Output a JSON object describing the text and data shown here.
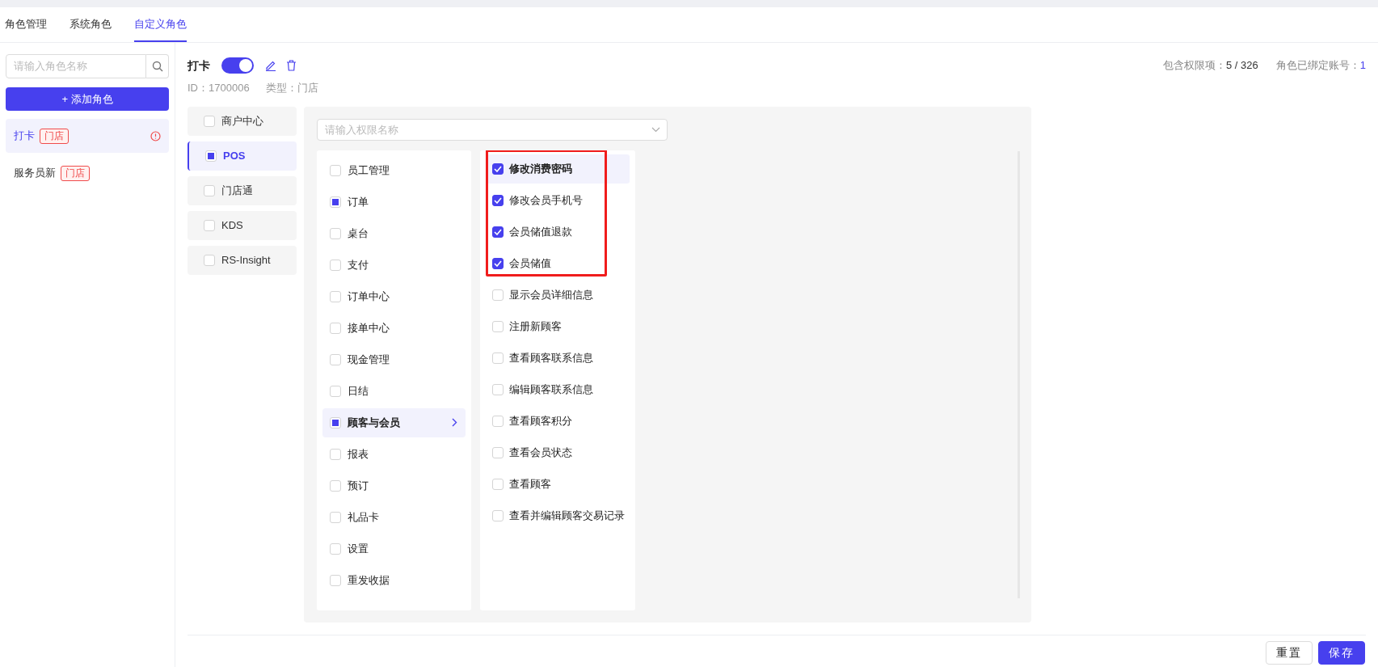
{
  "tabs": [
    {
      "label": "角色管理",
      "selected": false
    },
    {
      "label": "系统角色",
      "selected": false
    },
    {
      "label": "自定义角色",
      "selected": true
    }
  ],
  "sidebar": {
    "search": {
      "placeholder": "请输入角色名称"
    },
    "add_button": "+ 添加角色",
    "roles": [
      {
        "name": "打卡",
        "tag": "门店",
        "selected": true,
        "warning": true
      },
      {
        "name": "服务员新",
        "tag": "门店",
        "selected": false,
        "warning": false
      }
    ]
  },
  "role": {
    "title": "打卡",
    "enabled": true,
    "id_label": "ID：",
    "id": "1700006",
    "type_label": "类型：",
    "type": "门店",
    "permissions_label": "包含权限项：",
    "permissions_count": "5 / 326",
    "accounts_label": "角色已绑定账号：",
    "accounts_count": "1"
  },
  "modules": [
    {
      "label": "商户中心",
      "checked": false,
      "partial": false,
      "selected": false
    },
    {
      "label": "POS",
      "checked": false,
      "partial": true,
      "selected": true
    },
    {
      "label": "门店通",
      "checked": false,
      "partial": false,
      "selected": false
    },
    {
      "label": "KDS",
      "checked": false,
      "partial": false,
      "selected": false
    },
    {
      "label": "RS-Insight",
      "checked": false,
      "partial": false,
      "selected": false
    }
  ],
  "permission_search": {
    "placeholder": "请输入权限名称"
  },
  "categories": [
    {
      "label": "员工管理",
      "checked": false,
      "partial": false,
      "selected": false
    },
    {
      "label": "订单",
      "checked": false,
      "partial": true,
      "selected": false
    },
    {
      "label": "桌台",
      "checked": false,
      "partial": false,
      "selected": false
    },
    {
      "label": "支付",
      "checked": false,
      "partial": false,
      "selected": false
    },
    {
      "label": "订单中心",
      "checked": false,
      "partial": false,
      "selected": false
    },
    {
      "label": "接单中心",
      "checked": false,
      "partial": false,
      "selected": false
    },
    {
      "label": "现金管理",
      "checked": false,
      "partial": false,
      "selected": false
    },
    {
      "label": "日结",
      "checked": false,
      "partial": false,
      "selected": false
    },
    {
      "label": "顾客与会员",
      "checked": false,
      "partial": true,
      "selected": true
    },
    {
      "label": "报表",
      "checked": false,
      "partial": false,
      "selected": false
    },
    {
      "label": "预订",
      "checked": false,
      "partial": false,
      "selected": false
    },
    {
      "label": "礼品卡",
      "checked": false,
      "partial": false,
      "selected": false
    },
    {
      "label": "设置",
      "checked": false,
      "partial": false,
      "selected": false
    },
    {
      "label": "重发收据",
      "checked": false,
      "partial": false,
      "selected": false
    }
  ],
  "permissions": [
    {
      "label": "修改消费密码",
      "checked": true,
      "selected": true,
      "highlighted": true
    },
    {
      "label": "修改会员手机号",
      "checked": true,
      "selected": false,
      "highlighted": true
    },
    {
      "label": "会员储值退款",
      "checked": true,
      "selected": false,
      "highlighted": true
    },
    {
      "label": "会员储值",
      "checked": true,
      "selected": false,
      "highlighted": true
    },
    {
      "label": "显示会员详细信息",
      "checked": false,
      "selected": false,
      "highlighted": false
    },
    {
      "label": "注册新顾客",
      "checked": false,
      "selected": false,
      "highlighted": false
    },
    {
      "label": "查看顾客联系信息",
      "checked": false,
      "selected": false,
      "highlighted": false
    },
    {
      "label": "编辑顾客联系信息",
      "checked": false,
      "selected": false,
      "highlighted": false
    },
    {
      "label": "查看顾客积分",
      "checked": false,
      "selected": false,
      "highlighted": false
    },
    {
      "label": "查看会员状态",
      "checked": false,
      "selected": false,
      "highlighted": false
    },
    {
      "label": "查看顾客",
      "checked": false,
      "selected": false,
      "highlighted": false
    },
    {
      "label": "查看并编辑顾客交易记录",
      "checked": false,
      "selected": false,
      "highlighted": false
    }
  ],
  "buttons": [
    {
      "label": "重置",
      "kind": "secondary"
    },
    {
      "label": "保存",
      "kind": "primary"
    }
  ]
}
